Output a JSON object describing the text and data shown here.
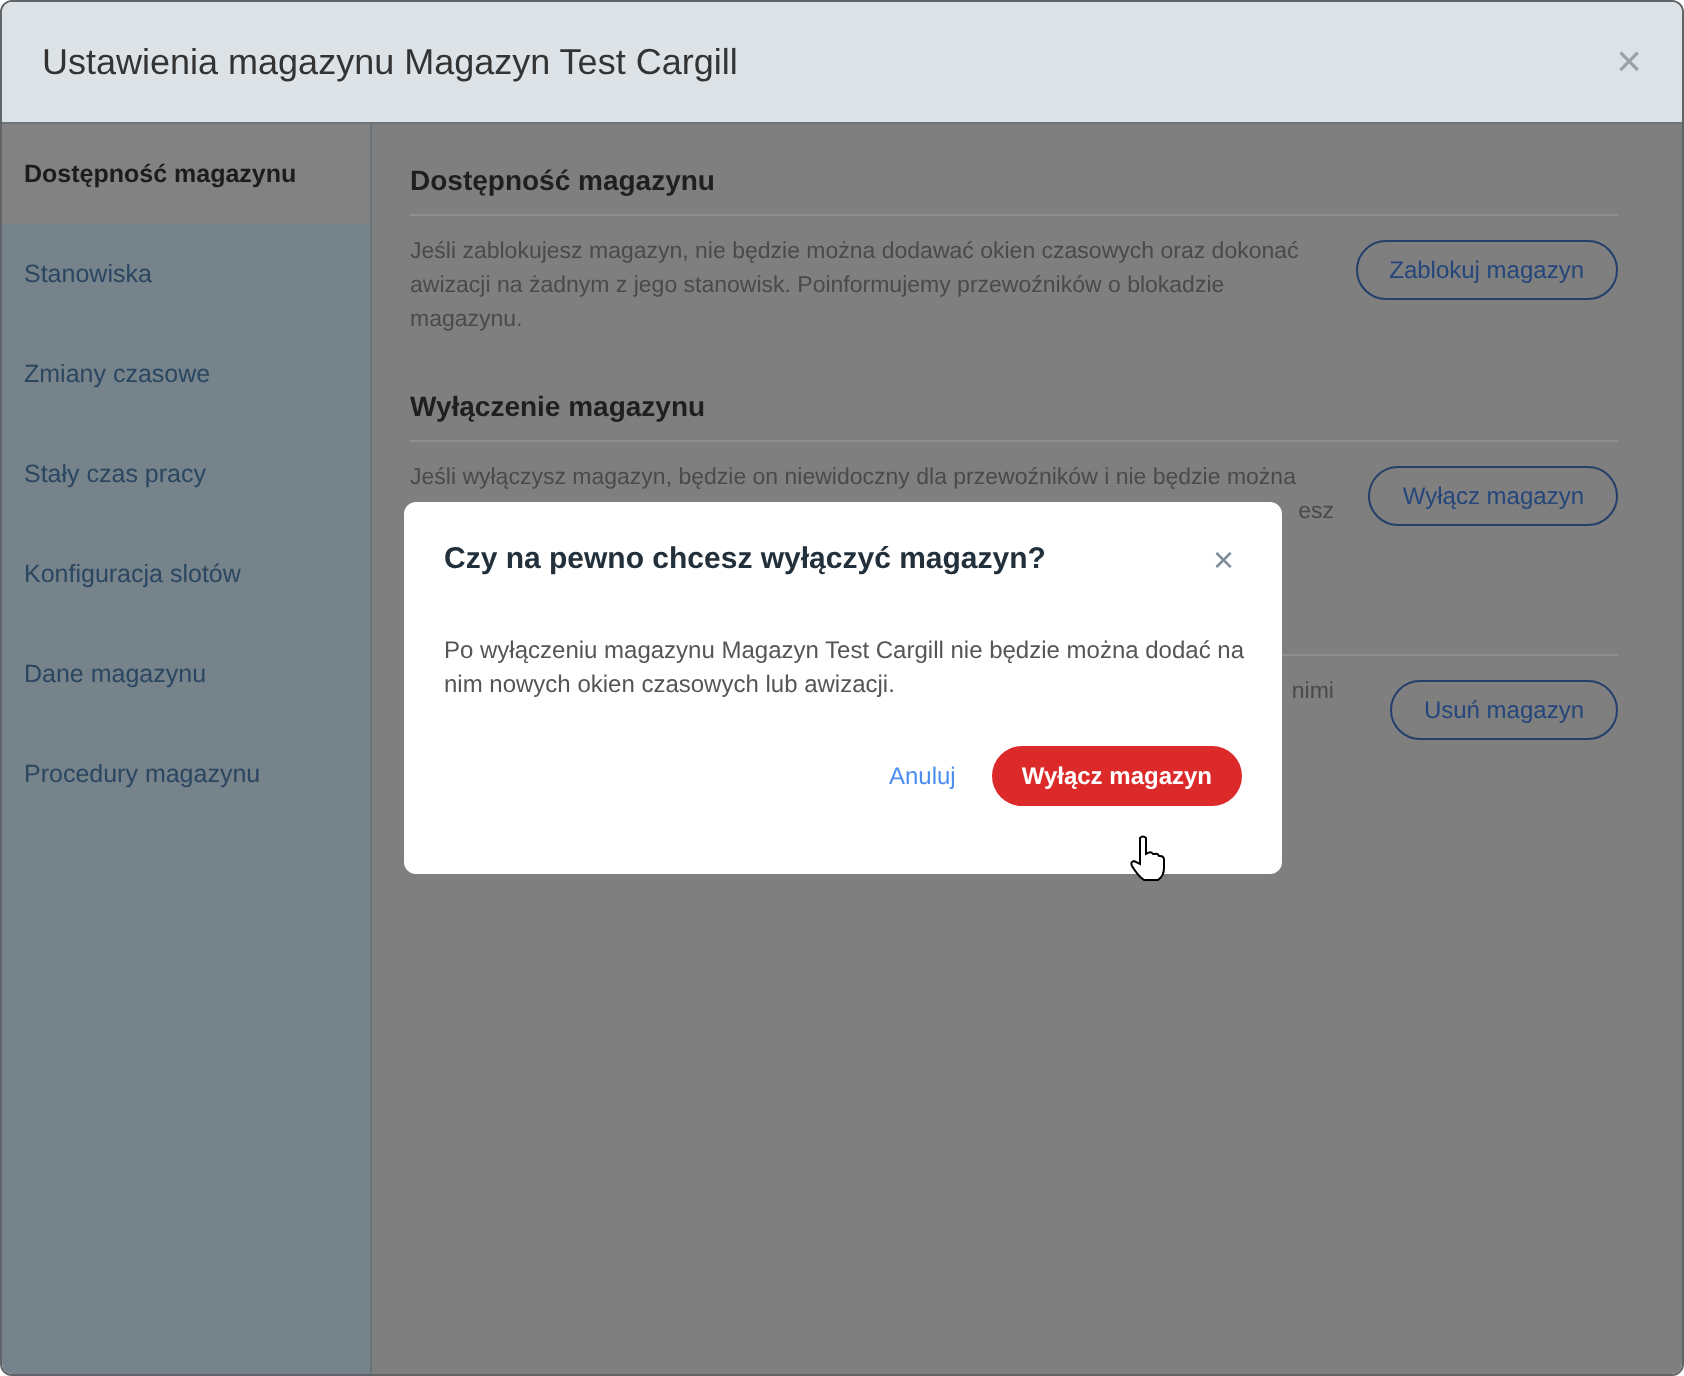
{
  "window": {
    "title": "Ustawienia magazynu Magazyn Test Cargill",
    "close": "×"
  },
  "sidebar": {
    "items": [
      {
        "label": "Dostępność magazynu",
        "selected": true
      },
      {
        "label": "Stanowiska",
        "selected": false
      },
      {
        "label": "Zmiany czasowe",
        "selected": false
      },
      {
        "label": "Stały czas pracy",
        "selected": false
      },
      {
        "label": "Konfiguracja slotów",
        "selected": false
      },
      {
        "label": "Dane magazynu",
        "selected": false
      },
      {
        "label": "Procedury magazynu",
        "selected": false
      }
    ]
  },
  "sections": [
    {
      "heading": "Dostępność magazynu",
      "lines": [
        "Jeśli zablokujesz magazyn, nie będzie można dodawać okien czasowych oraz dokonać awizacji na żadnym z jego stanowisk. Poinformujemy przewoźników o blokadzie magazynu."
      ],
      "button": "Zablokuj magazyn"
    },
    {
      "heading": "Wyłączenie magazynu",
      "lines": [
        "Jeśli wyłączysz magazyn, będzie on niewidoczny dla przewoźników i nie będzie można",
        "esz"
      ],
      "button": "Wyłącz magazyn"
    },
    {
      "lines": [
        "nimi"
      ],
      "button": "Usuń magazyn"
    }
  ],
  "dialog": {
    "title": "Czy na pewno chcesz wyłączyć magazyn?",
    "close": "×",
    "message": "Po wyłączeniu magazynu Magazyn Test Cargill nie będzie można dodać na nim nowych okien czasowych lub awizacji.",
    "cancel": "Anuluj",
    "confirm": "Wyłącz magazyn"
  }
}
